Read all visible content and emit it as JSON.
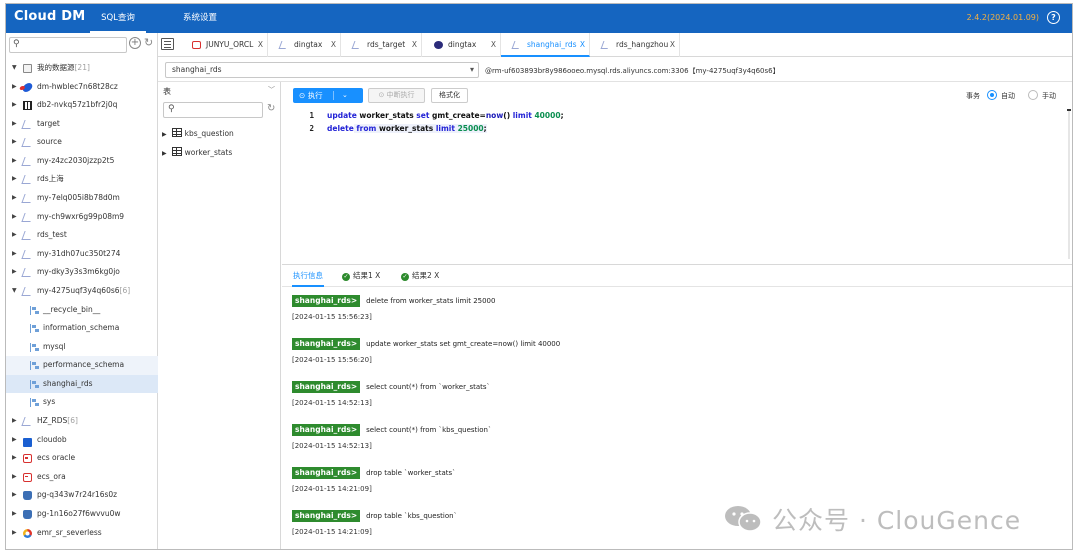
{
  "header": {
    "logo": "Cloud DM",
    "nav": [
      "SQL查询",
      "系统设置"
    ],
    "version": "2.4.2(2024.01.09)",
    "help": "?"
  },
  "tree": {
    "search_placeholder": "",
    "rows": [
      {
        "label": "我的数据源",
        "count": "[21]",
        "icon": "folder-icon",
        "caret": "▼",
        "indent": 0
      },
      {
        "label": "dm-hwblec7n68t28cz",
        "icon": "dm-db-icon",
        "caret": "▶",
        "indent": 0
      },
      {
        "label": "db2-nvkq57z1bfr2j0q",
        "icon": "db2-icon",
        "caret": "▶",
        "indent": 0
      },
      {
        "label": "target",
        "icon": "mysql-dolphin-icon",
        "caret": "▶",
        "indent": 0
      },
      {
        "label": "source",
        "icon": "mysql-dolphin-icon",
        "caret": "▶",
        "indent": 0
      },
      {
        "label": "my-z4zc2030jzzp2t5",
        "icon": "mysql-dolphin-icon",
        "caret": "▶",
        "indent": 0
      },
      {
        "label": "rds上海",
        "icon": "mysql-dolphin-icon",
        "caret": "▶",
        "indent": 0
      },
      {
        "label": "my-7elq005i8b78d0m",
        "icon": "mysql-dolphin-icon",
        "caret": "▶",
        "indent": 0
      },
      {
        "label": "my-ch9wxr6g99p08m9",
        "icon": "mysql-dolphin-icon",
        "caret": "▶",
        "indent": 0
      },
      {
        "label": "rds_test",
        "icon": "mysql-dolphin-icon",
        "caret": "▶",
        "indent": 0
      },
      {
        "label": "my-31dh07uc350t274",
        "icon": "mysql-dolphin-icon",
        "caret": "▶",
        "indent": 0
      },
      {
        "label": "my-dky3y3s3m6kg0jo",
        "icon": "mysql-dolphin-icon",
        "caret": "▶",
        "indent": 0
      },
      {
        "label": "my-4275uqf3y4q60s6",
        "count": "[6]",
        "icon": "mysql-dolphin-icon",
        "caret": "▼",
        "indent": 0
      },
      {
        "label": "__recycle_bin__",
        "icon": "schema-icon",
        "caret": "",
        "indent": 1
      },
      {
        "label": "information_schema",
        "icon": "schema-icon",
        "caret": "",
        "indent": 1
      },
      {
        "label": "mysql",
        "icon": "schema-icon",
        "caret": "",
        "indent": 1
      },
      {
        "label": "performance_schema",
        "icon": "schema-icon",
        "caret": "",
        "indent": 1,
        "state": "hov"
      },
      {
        "label": "shanghai_rds",
        "icon": "schema-icon",
        "caret": "",
        "indent": 1,
        "state": "sel"
      },
      {
        "label": "sys",
        "icon": "schema-icon",
        "caret": "",
        "indent": 1
      },
      {
        "label": "HZ_RDS",
        "count": "[6]",
        "icon": "mysql-dolphin-icon",
        "caret": "▶",
        "indent": 0
      },
      {
        "label": "cloudob",
        "icon": "oceanbase-icon",
        "caret": "▶",
        "indent": 0
      },
      {
        "label": "ecs oracle",
        "icon": "oracle-icon",
        "caret": "▶",
        "indent": 0
      },
      {
        "label": "ecs_ora",
        "icon": "oracle-icon",
        "caret": "▶",
        "indent": 0
      },
      {
        "label": "pg-q343w7r24r16s0z",
        "icon": "postgres-icon",
        "caret": "▶",
        "indent": 0
      },
      {
        "label": "pg-1n16o27f6wvvu0w",
        "icon": "postgres-icon",
        "caret": "▶",
        "indent": 0
      },
      {
        "label": "emr_sr_severless",
        "icon": "emr-icon",
        "caret": "▶",
        "indent": 0
      }
    ]
  },
  "tabs": [
    {
      "label": "JUNYU_ORCL",
      "icon": "oracle-icon",
      "close": "X"
    },
    {
      "label": "dingtax",
      "icon": "mysql-dolphin-icon",
      "close": "X"
    },
    {
      "label": "rds_target",
      "icon": "mysql-dolphin-icon",
      "close": "X"
    },
    {
      "label": "dingtax",
      "icon": "postgres-icon",
      "close": "X"
    },
    {
      "label": "shanghai_rds",
      "icon": "mysql-dolphin-icon",
      "close": "X",
      "active": true
    },
    {
      "label": "rds_hangzhou",
      "icon": "mysql-dolphin-icon",
      "close": "X"
    }
  ],
  "connection": {
    "schema": "shanghai_rds",
    "info": "@rm-uf603893br8y986ooeo.mysql.rds.aliyuncs.com:3306【my-4275uqf3y4q60s6】"
  },
  "table_panel": {
    "type_label": "表",
    "search_placeholder": "",
    "tables": [
      "kbs_question",
      "worker_stats"
    ]
  },
  "toolbar": {
    "run": "执行",
    "stop": "中断执行",
    "format": "格式化",
    "transaction": "事务",
    "auto": "自动",
    "manual": "手动",
    "mode": "auto"
  },
  "editor": {
    "lines": [
      {
        "no": "1",
        "tokens": [
          {
            "t": "update",
            "c": "kw"
          },
          {
            "t": " worker_stats ",
            "c": "idf"
          },
          {
            "t": "set",
            "c": "kw"
          },
          {
            "t": " gmt_create",
            "c": "idf"
          },
          {
            "t": "=",
            "c": "idf"
          },
          {
            "t": "now",
            "c": "fn"
          },
          {
            "t": "()",
            "c": "idf"
          },
          {
            "t": " limit ",
            "c": "kw"
          },
          {
            "t": "40000",
            "c": "num"
          },
          {
            "t": ";",
            "c": "idf"
          }
        ]
      },
      {
        "no": "2",
        "tokens": [
          {
            "t": "delete",
            "c": "kw"
          },
          {
            "t": " from ",
            "c": "kw"
          },
          {
            "t": "worker_stats",
            "c": "idf"
          },
          {
            "t": " limit ",
            "c": "kw"
          },
          {
            "t": "25000",
            "c": "num"
          },
          {
            "t": ";",
            "c": "idf"
          }
        ]
      }
    ]
  },
  "results": {
    "tabs": [
      {
        "label": "执行信息",
        "active": true
      },
      {
        "label": "结果1",
        "ok": true,
        "close": "X"
      },
      {
        "label": "结果2",
        "ok": true,
        "close": "X"
      }
    ],
    "logs": [
      {
        "tag": "shanghai_rds>",
        "sql": "delete from worker_stats limit 25000",
        "ts": "[2024-01-15 15:56:23]"
      },
      {
        "tag": "shanghai_rds>",
        "sql": "update worker_stats set gmt_create=now() limit 40000",
        "ts": "[2024-01-15 15:56:20]"
      },
      {
        "tag": "shanghai_rds>",
        "sql": "select count(*) from `worker_stats`",
        "ts": "[2024-01-15 14:52:13]"
      },
      {
        "tag": "shanghai_rds>",
        "sql": "select count(*) from `kbs_question`",
        "ts": "[2024-01-15 14:52:13]"
      },
      {
        "tag": "shanghai_rds>",
        "sql": "drop table `worker_stats`",
        "ts": "[2024-01-15 14:21:09]"
      },
      {
        "tag": "shanghai_rds>",
        "sql": "drop table `kbs_question`",
        "ts": "[2024-01-15 14:21:09]"
      }
    ]
  },
  "watermark": {
    "text": "公众号 · ClouGence",
    "icon": "wechat-icon"
  },
  "colors": {
    "brand": "#1565c0",
    "accent": "#1890ff",
    "success": "#2e8b2e",
    "version": "#f4b041"
  }
}
